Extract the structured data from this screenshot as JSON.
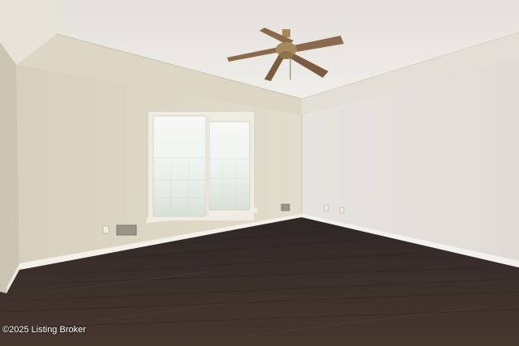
{
  "photo": {
    "watermark": "©2025 Listing Broker",
    "colors": {
      "ceiling": "#ebe8e0",
      "left_wall": "#ddd6c5",
      "right_wall": "#e4e1da",
      "floor": "#3a2f2b",
      "baseboard": "#f2efe8",
      "window_glass": "#f4f6f4",
      "fan_blade": "#8a6a4e",
      "fan_brass": "#a6895a"
    }
  }
}
